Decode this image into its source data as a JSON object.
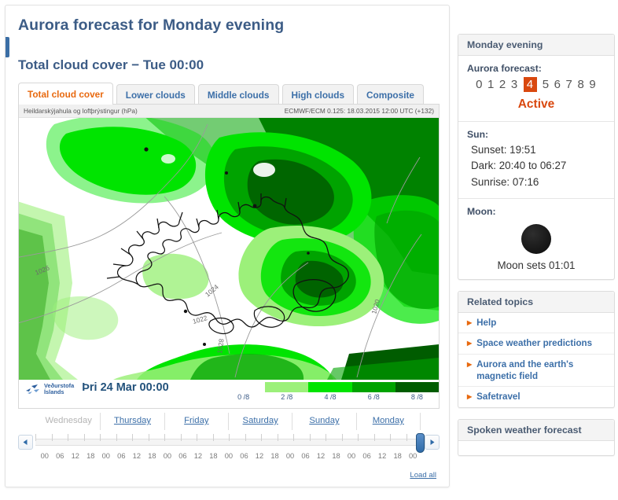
{
  "page": {
    "title": "Aurora forecast for Monday evening",
    "section_title": "Total cloud cover − Tue 00:00"
  },
  "tabs": [
    {
      "label": "Total cloud cover",
      "active": true
    },
    {
      "label": "Lower clouds",
      "active": false
    },
    {
      "label": "Middle clouds",
      "active": false
    },
    {
      "label": "High clouds",
      "active": false
    },
    {
      "label": "Composite",
      "active": false
    }
  ],
  "map": {
    "header_left": "Heildarskýjahula og loftþrýstingur (hPa)",
    "header_right": "ECMWF/ECM 0.125: 18.03.2015 12:00 UTC (+132)",
    "logo_line1": "Veðurstofa",
    "logo_line2": "Íslands",
    "valid_time": "Þri 24 Mar 00:00",
    "contour_labels": [
      "1026",
      "1028",
      "1024",
      "1022",
      "1020"
    ],
    "legend": {
      "ticks": [
        "0 /8",
        "2 /8",
        "4 /8",
        "6 /8",
        "8 /8"
      ],
      "colors": [
        "#ffffff",
        "#9cf07a",
        "#00e400",
        "#00a300",
        "#005c00"
      ]
    }
  },
  "timeline": {
    "days": [
      {
        "label": "Wednesday",
        "enabled": false
      },
      {
        "label": "Thursday",
        "enabled": true
      },
      {
        "label": "Friday",
        "enabled": true
      },
      {
        "label": "Saturday",
        "enabled": true
      },
      {
        "label": "Sunday",
        "enabled": true
      },
      {
        "label": "Monday",
        "enabled": true
      }
    ],
    "hours": [
      "00",
      "06",
      "12",
      "18",
      "00",
      "06",
      "12",
      "18",
      "00",
      "06",
      "12",
      "18",
      "00",
      "06",
      "12",
      "18",
      "00",
      "06",
      "12",
      "18",
      "00",
      "06",
      "12",
      "18",
      "00"
    ],
    "prev_label": "◀",
    "next_label": "▶",
    "load_all": "Load all"
  },
  "sidebar": {
    "forecast_panel": {
      "head": "Monday evening",
      "aurora_label": "Aurora forecast:",
      "scale": [
        "0",
        "1",
        "2",
        "3",
        "4",
        "5",
        "6",
        "7",
        "8",
        "9"
      ],
      "selected_index": 4,
      "state": "Active",
      "state_color": "#d9480f",
      "sun_label": "Sun:",
      "sun_lines": [
        "Sunset: 19:51",
        "Dark: 20:40 to 06:27",
        "Sunrise: 07:16"
      ],
      "moon_label": "Moon:",
      "moon_text": "Moon sets 01:01"
    },
    "related_panel": {
      "head": "Related topics",
      "items": [
        "Help",
        "Space weather predictions",
        "Aurora and the earth's magnetic field",
        "Safetravel"
      ]
    },
    "spoken_panel": {
      "head": "Spoken weather forecast"
    }
  }
}
